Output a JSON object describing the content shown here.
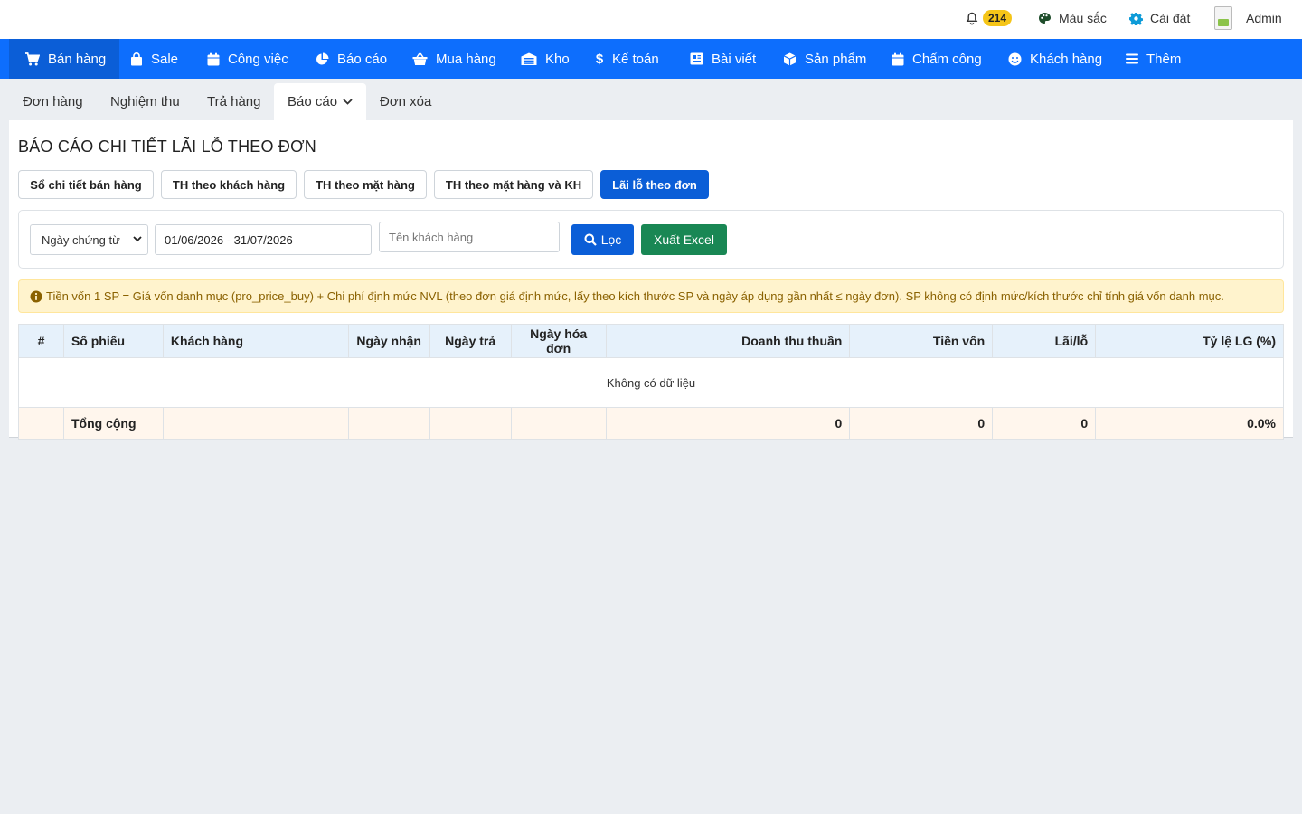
{
  "topbar": {
    "notif_count": "214",
    "mau_sac": "Màu sắc",
    "cai_dat": "Cài đặt",
    "admin": "Admin"
  },
  "nav": [
    {
      "label": "Bán hàng",
      "icon": "cart-icon"
    },
    {
      "label": "Sale",
      "icon": "bag-icon"
    },
    {
      "label": "Công việc",
      "icon": "calendar-icon"
    },
    {
      "label": "Báo cáo",
      "icon": "pie-chart-icon"
    },
    {
      "label": "Mua hàng",
      "icon": "basket-icon"
    },
    {
      "label": "Kho",
      "icon": "warehouse-icon"
    },
    {
      "label": "Kế toán",
      "icon": "dollar-icon"
    },
    {
      "label": "Bài viết",
      "icon": "newspaper-icon"
    },
    {
      "label": "Sản phẩm",
      "icon": "box-icon"
    },
    {
      "label": "Chấm công",
      "icon": "calendar-icon"
    },
    {
      "label": "Khách hàng",
      "icon": "smile-icon"
    },
    {
      "label": "Thêm",
      "icon": "menu-icon"
    }
  ],
  "subtabs": [
    "Đơn hàng",
    "Nghiệm thu",
    "Trả hàng",
    "Báo cáo",
    "Đơn xóa"
  ],
  "page_title": "BÁO CÁO CHI TIẾT LÃI LỖ THEO ĐƠN",
  "report_buttons": [
    "Sổ chi tiết bán hàng",
    "TH theo khách hàng",
    "TH theo mặt hàng",
    "TH theo mặt hàng và KH",
    "Lãi lỗ theo đơn"
  ],
  "filter": {
    "date_type": "Ngày chứng từ",
    "date_range": "01/06/2026 - 31/07/2026",
    "customer_placeholder": "Tên khách hàng",
    "filter_button": "Lọc",
    "excel_button": "Xuất Excel"
  },
  "alert": "Tiền vốn 1 SP = Giá vốn danh mục (pro_price_buy) + Chi phí định mức NVL (theo đơn giá định mức, lấy theo kích thước SP và ngày áp dụng gần nhất ≤ ngày đơn). SP không có định mức/kích thước chỉ tính giá vốn danh mục.",
  "table": {
    "headers": [
      "#",
      "Số phiếu",
      "Khách hàng",
      "Ngày nhận",
      "Ngày trả",
      "Ngày hóa đơn",
      "Doanh thu thuần",
      "Tiền vốn",
      "Lãi/lỗ",
      "Tỷ lệ LG (%)"
    ],
    "empty_text": "Không có dữ liệu",
    "total": {
      "label": "Tổng cộng",
      "doanh_thu": "0",
      "tien_von": "0",
      "lai_lo": "0",
      "ty_le": "0.0%"
    }
  }
}
